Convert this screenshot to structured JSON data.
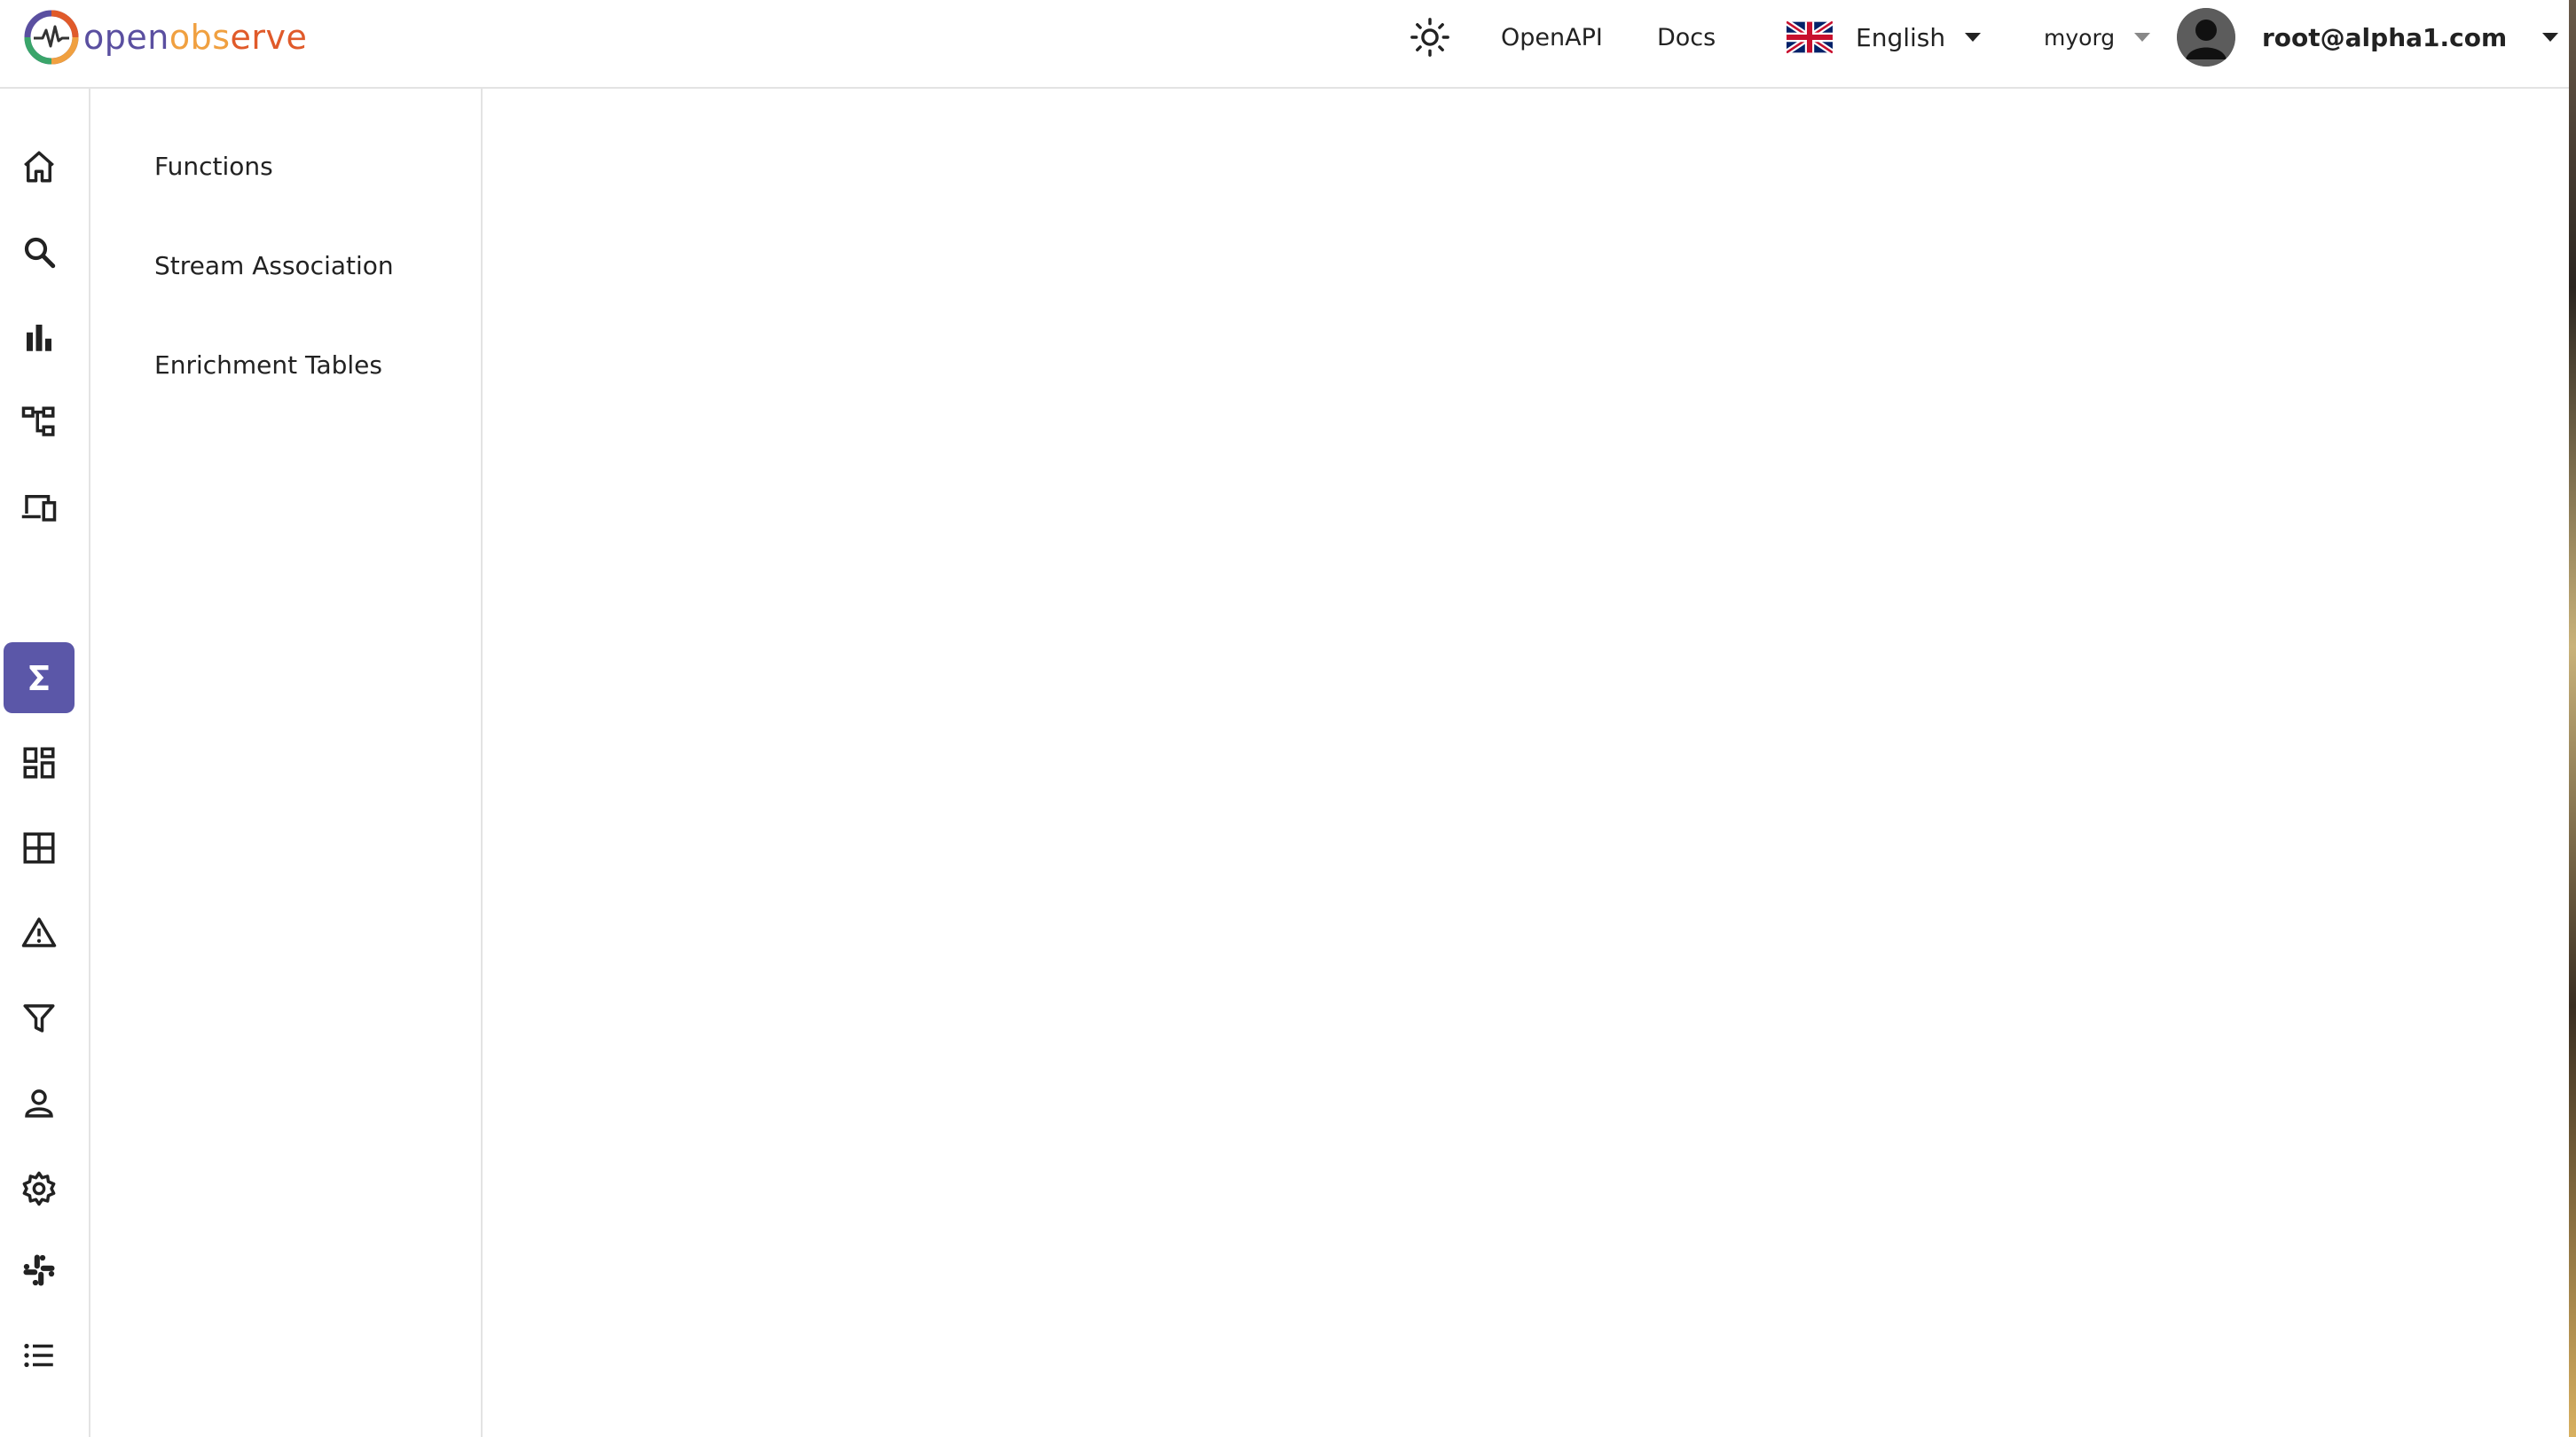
{
  "header": {
    "logo_text_open": "open",
    "logo_text_obs": "obs",
    "logo_text_erve": "erve",
    "theme_icon": "sun-icon",
    "openapi_label": "OpenAPI",
    "docs_label": "Docs",
    "language": {
      "flag_icon": "uk-flag-icon",
      "label": "English"
    },
    "org": "myorg",
    "user": "root@alpha1.com"
  },
  "sidebar": {
    "items": [
      {
        "name": "home",
        "icon": "home-icon",
        "active": false
      },
      {
        "name": "search",
        "icon": "search-icon",
        "active": false
      },
      {
        "name": "metrics",
        "icon": "bar-chart-icon",
        "active": false
      },
      {
        "name": "traces",
        "icon": "tree-icon",
        "active": false
      },
      {
        "name": "rum",
        "icon": "devices-icon",
        "active": false
      },
      {
        "name": "pipeline",
        "icon": "sigma-icon",
        "active": true
      },
      {
        "name": "dashboards",
        "icon": "dashboard-icon",
        "active": false
      },
      {
        "name": "streams",
        "icon": "grid-icon",
        "active": false
      },
      {
        "name": "alerts",
        "icon": "warning-icon",
        "active": false
      },
      {
        "name": "ingestion",
        "icon": "filter-icon",
        "active": false
      },
      {
        "name": "iam",
        "icon": "person-icon",
        "active": false
      },
      {
        "name": "settings",
        "icon": "gear-icon",
        "active": false
      },
      {
        "name": "slack",
        "icon": "slack-icon",
        "active": false
      },
      {
        "name": "about",
        "icon": "list-icon",
        "active": false
      }
    ]
  },
  "submenu": {
    "items": [
      {
        "label": "Functions"
      },
      {
        "label": "Stream Association"
      },
      {
        "label": "Enrichment Tables"
      }
    ]
  },
  "colors": {
    "accent": "#5b57a8",
    "border": "#e3e3e3"
  }
}
